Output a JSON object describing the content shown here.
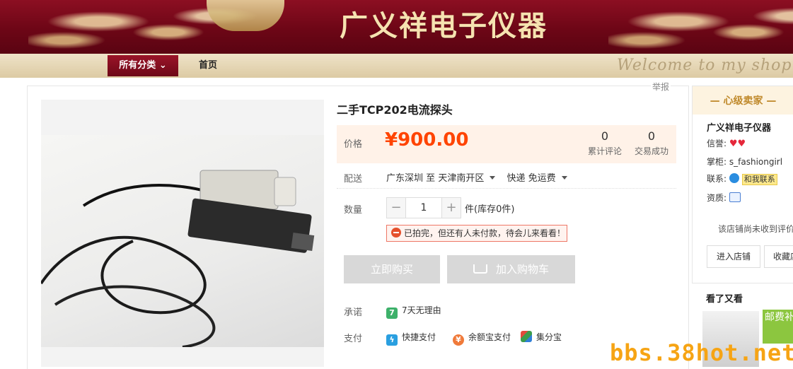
{
  "shop_banner": {
    "title": "广义祥电子仪器"
  },
  "nav": {
    "all_categories": "所有分类",
    "home": "首页",
    "welcome": "Welcome to my shop"
  },
  "report": "举报",
  "product": {
    "title": "二手TCP202电流探头",
    "price_label": "价格",
    "price": "¥900.00",
    "reviews_count": "0",
    "reviews_label": "累计评论",
    "deals_count": "0",
    "deals_label": "交易成功",
    "shipping_label": "配送",
    "ship_from": "广东深圳",
    "ship_to_word": "至",
    "ship_to": "天津南开区",
    "ship_method": "快递 免运费",
    "qty_label": "数量",
    "qty_minus": "−",
    "qty_value": "1",
    "qty_plus": "+",
    "stock_text": "件(库存0件)",
    "notice": "已拍完，但还有人未付款，待会儿来看看！",
    "buy_now": "立即购买",
    "add_cart": "加入购物车",
    "promise_label": "承诺",
    "promise_item": "7天无理由",
    "promise_icon_text": "7",
    "pay_label": "支付",
    "pay_methods": [
      "快捷支付",
      "余额宝支付",
      "集分宝"
    ]
  },
  "seller": {
    "header": "心级卖家",
    "name": "广义祥电子仪器",
    "credit_label": "信誉:",
    "manager_label": "掌柜:",
    "manager": "s_fashiongirl",
    "contact_label": "联系:",
    "contact_btn": "和我联系",
    "cert_label": "资质:",
    "no_eval": "该店铺尚未收到评价",
    "enter_shop": "进入店铺",
    "favorite": "收藏店"
  },
  "also_viewed": {
    "title": "看了又看",
    "promo": "邮费补 产品补"
  },
  "watermark": "bbs.38hot.net",
  "colors": {
    "brand_red": "#7a0a1a",
    "price_orange": "#ff4400",
    "gold": "#c08a2c"
  }
}
